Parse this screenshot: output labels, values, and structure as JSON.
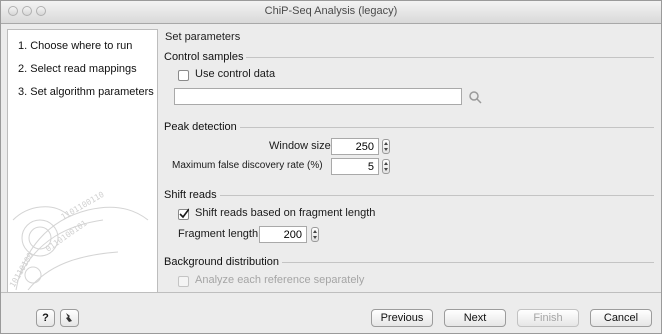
{
  "window": {
    "title": "ChiP-Seq Analysis (legacy)"
  },
  "steps": [
    "1.  Choose where to run",
    "2.  Select read mappings",
    "3.  Set algorithm parameters"
  ],
  "main": {
    "section_title": "Set parameters"
  },
  "control_samples": {
    "title": "Control samples",
    "use_control_label": "Use control data",
    "use_control_checked": false,
    "field_value": ""
  },
  "peak_detection": {
    "title": "Peak detection",
    "window_size_label": "Window size",
    "window_size_value": "250",
    "fdr_label": "Maximum false discovery rate (%)",
    "fdr_value": "5"
  },
  "shift_reads": {
    "title": "Shift reads",
    "shift_label": "Shift reads based on fragment length",
    "shift_checked": true,
    "fragment_label": "Fragment length",
    "fragment_value": "200"
  },
  "background": {
    "title": "Background distribution",
    "analyze_label": "Analyze each reference separately",
    "analyze_checked": false,
    "analyze_disabled": true
  },
  "footer": {
    "help_label": "?",
    "previous_label": "Previous",
    "next_label": "Next",
    "finish_label": "Finish",
    "cancel_label": "Cancel"
  }
}
